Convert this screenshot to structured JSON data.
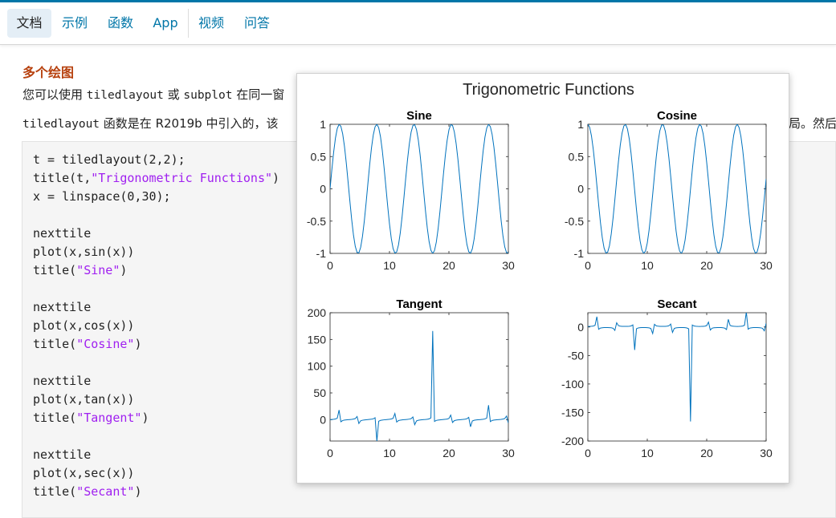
{
  "nav": {
    "items": [
      {
        "label": "文档",
        "active": true
      },
      {
        "label": "示例",
        "active": false
      },
      {
        "label": "函数",
        "active": false
      },
      {
        "label": "App",
        "active": false
      },
      {
        "label": "视频",
        "active": false
      },
      {
        "label": "问答",
        "active": false
      }
    ]
  },
  "content": {
    "section_title": "多个绘图",
    "para1_prefix": "您可以使用 ",
    "para1_code1": "tiledlayout",
    "para1_mid": " 或 ",
    "para1_code2": "subplot",
    "para1_suffix": " 在同一窗",
    "para2_code": "tiledlayout",
    "para2_text": " 函数是在 R2019b 中引入的，该",
    "para2_right": "局。然后",
    "code_lines": [
      [
        {
          "t": "t = tiledlayout(2,2);"
        }
      ],
      [
        {
          "t": "title(t,"
        },
        {
          "t": "\"Trigonometric Functions\"",
          "s": 1
        },
        {
          "t": ")"
        }
      ],
      [
        {
          "t": "x = linspace(0,30);"
        }
      ],
      [],
      [
        {
          "t": "nexttile"
        }
      ],
      [
        {
          "t": "plot(x,sin(x))"
        }
      ],
      [
        {
          "t": "title("
        },
        {
          "t": "\"Sine\"",
          "s": 1
        },
        {
          "t": ")"
        }
      ],
      [],
      [
        {
          "t": "nexttile"
        }
      ],
      [
        {
          "t": "plot(x,cos(x))"
        }
      ],
      [
        {
          "t": "title("
        },
        {
          "t": "\"Cosine\"",
          "s": 1
        },
        {
          "t": ")"
        }
      ],
      [],
      [
        {
          "t": "nexttile"
        }
      ],
      [
        {
          "t": "plot(x,tan(x))"
        }
      ],
      [
        {
          "t": "title("
        },
        {
          "t": "\"Tangent\"",
          "s": 1
        },
        {
          "t": ")"
        }
      ],
      [],
      [
        {
          "t": "nexttile"
        }
      ],
      [
        {
          "t": "plot(x,sec(x))"
        }
      ],
      [
        {
          "t": "title("
        },
        {
          "t": "\"Secant\"",
          "s": 1
        },
        {
          "t": ")"
        }
      ]
    ]
  },
  "figure": {
    "title": "Trigonometric Functions",
    "line_color": "#0072bd"
  },
  "chart_data": [
    {
      "type": "line",
      "title": "Sine",
      "function": "sin",
      "points": 100,
      "xlim": [
        0,
        30
      ],
      "ylim": [
        -1,
        1
      ],
      "xticks": [
        0,
        10,
        20,
        30
      ],
      "yticks": [
        -1,
        -0.5,
        0,
        0.5,
        1
      ]
    },
    {
      "type": "line",
      "title": "Cosine",
      "function": "cos",
      "points": 100,
      "xlim": [
        0,
        30
      ],
      "ylim": [
        -1,
        1
      ],
      "xticks": [
        0,
        10,
        20,
        30
      ],
      "yticks": [
        -1,
        -0.5,
        0,
        0.5,
        1
      ]
    },
    {
      "type": "line",
      "title": "Tangent",
      "function": "tan",
      "points": 100,
      "xlim": [
        0,
        30
      ],
      "ylim": [
        -40,
        200
      ],
      "xticks": [
        0,
        10,
        20,
        30
      ],
      "yticks": [
        0,
        50,
        100,
        150,
        200
      ]
    },
    {
      "type": "line",
      "title": "Secant",
      "function": "sec",
      "points": 100,
      "xlim": [
        0,
        30
      ],
      "ylim": [
        -200,
        25
      ],
      "xticks": [
        0,
        10,
        20,
        30
      ],
      "yticks": [
        -200,
        -150,
        -100,
        -50,
        0
      ]
    }
  ]
}
